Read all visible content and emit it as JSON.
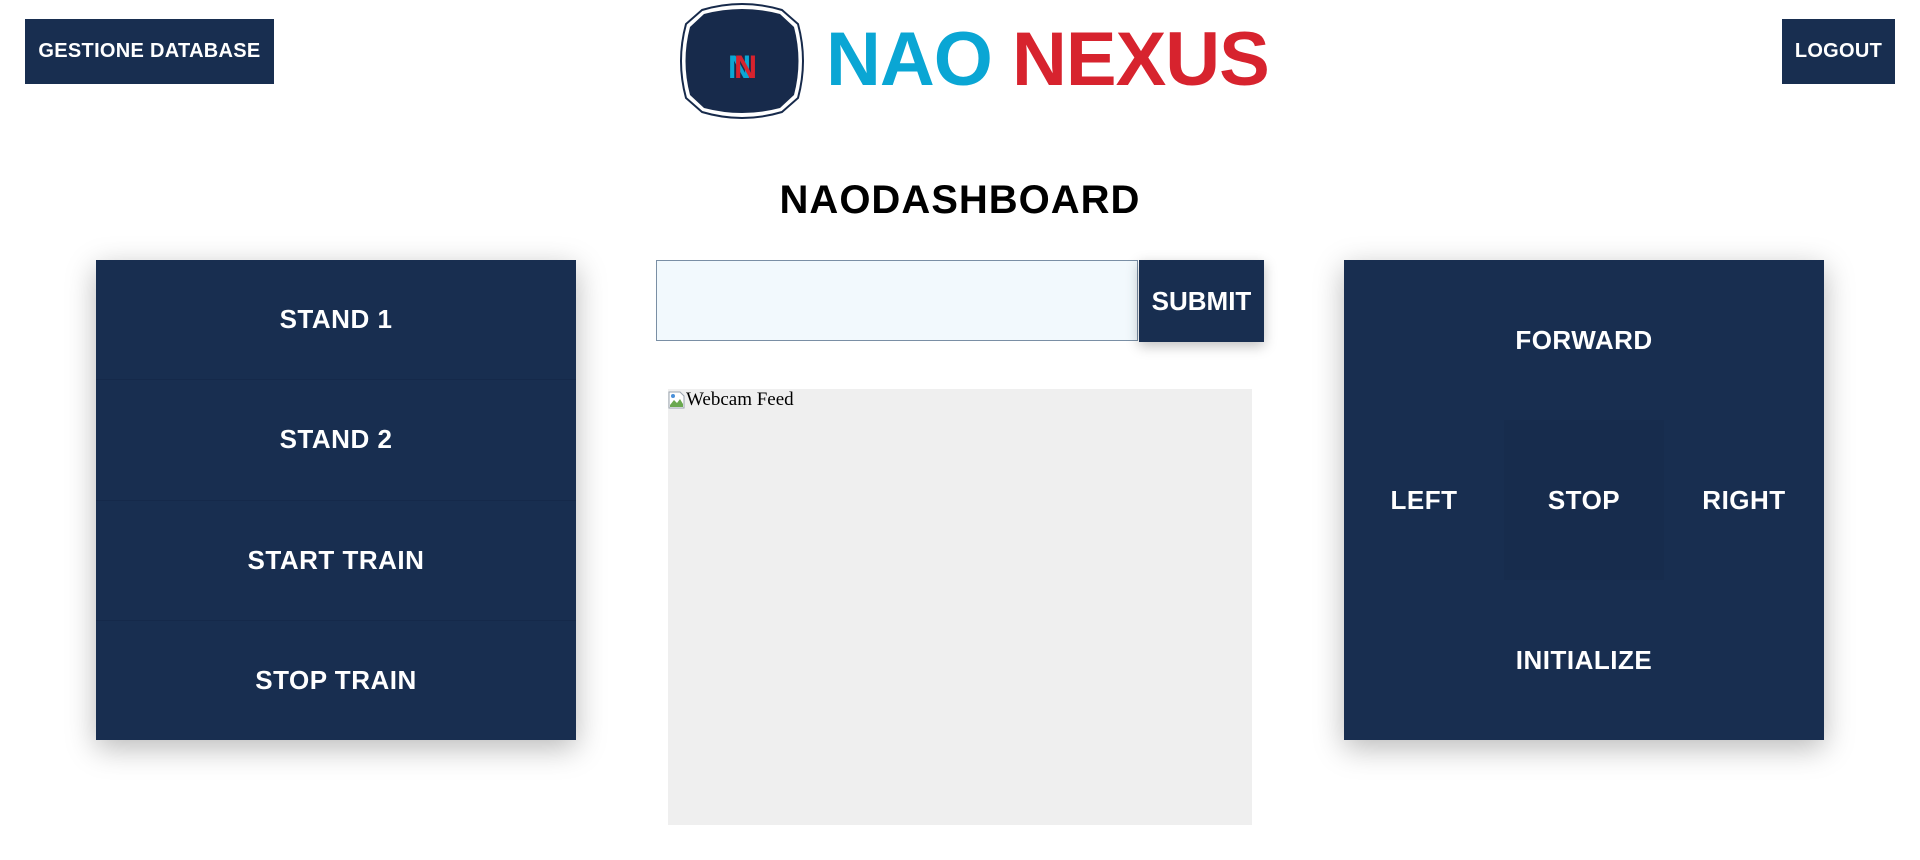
{
  "header": {
    "database_button": "GESTIONE DATABASE",
    "logout_button": "LOGOUT",
    "logo": {
      "badge_text": "N",
      "word1": "NAO",
      "word2": "NEXUS",
      "colors": {
        "word1": "#0aa6d4",
        "word2": "#d7232e",
        "badge": "#172a4b"
      }
    }
  },
  "page_title": "NAODASHBOARD",
  "left_panel": {
    "buttons": [
      "STAND 1",
      "STAND 2",
      "START TRAIN",
      "STOP TRAIN"
    ]
  },
  "command": {
    "input_value": "",
    "submit_label": "SUBMIT"
  },
  "webcam": {
    "alt_text": "Webcam Feed",
    "broken_image_icon": "broken-image-icon"
  },
  "right_panel": {
    "forward": "FORWARD",
    "left": "LEFT",
    "stop": "STOP",
    "right": "RIGHT",
    "initialize": "INITIALIZE"
  },
  "colors": {
    "primary": "#182e50",
    "input_bg": "#f2f9fd",
    "webcam_bg": "#efefef"
  }
}
